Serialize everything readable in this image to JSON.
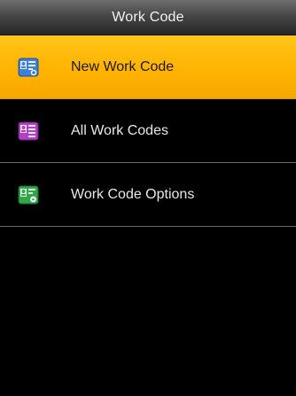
{
  "header": {
    "title": "Work Code"
  },
  "menu": {
    "items": [
      {
        "label": "New Work Code",
        "icon": "new-work-code-icon",
        "color": "#3f7fd6",
        "selected": true
      },
      {
        "label": "All Work Codes",
        "icon": "all-work-codes-icon",
        "color": "#b23fc4",
        "selected": false
      },
      {
        "label": "Work Code Options",
        "icon": "work-code-options-icon",
        "color": "#2fa84a",
        "selected": false
      }
    ]
  },
  "colors": {
    "background": "#000000",
    "selected_highlight": "#ffb300",
    "divider": "#6a6a6a"
  }
}
